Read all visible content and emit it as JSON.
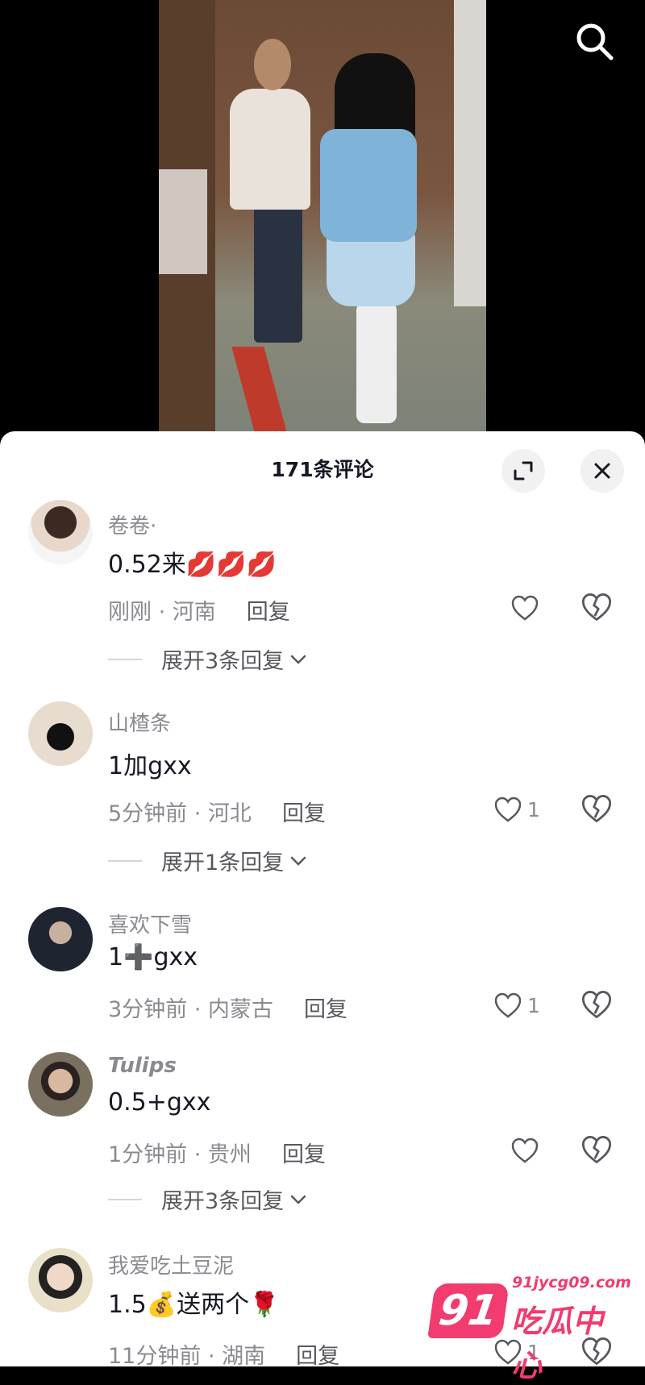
{
  "sheet": {
    "title": "171条评论"
  },
  "comments": [
    {
      "username": "卷卷·",
      "text": "0.52来💋💋💋",
      "time_location": "刚刚 · 河南",
      "reply_label": "回复",
      "likes": "",
      "expand_label": "展开3条回复"
    },
    {
      "username": "山楂条",
      "text": "1加gxx",
      "time_location": "5分钟前 · 河北",
      "reply_label": "回复",
      "likes": "1",
      "expand_label": "展开1条回复"
    },
    {
      "username": "喜欢下雪",
      "text": "1➕gxx",
      "time_location": "3分钟前 · 内蒙古",
      "reply_label": "回复",
      "likes": "1",
      "expand_label": ""
    },
    {
      "username": "Tulips",
      "text": "0.5+gxx",
      "time_location": "1分钟前 · 贵州",
      "reply_label": "回复",
      "likes": "",
      "expand_label": "展开3条回复"
    },
    {
      "username": "我爱吃土豆泥",
      "text": "1.5💰送两个🌹",
      "time_location": "11分钟前 · 湖南",
      "reply_label": "回复",
      "likes": "1",
      "expand_label": ""
    }
  ],
  "watermark": {
    "badge": "91",
    "url": "91jycg09.com",
    "name": "吃瓜中心"
  },
  "icons": {
    "search": "search-icon",
    "expand": "expand-icon",
    "close": "close-icon",
    "like": "heart-icon",
    "dislike": "broken-heart-icon",
    "chevron": "chevron-down-icon"
  },
  "colors": {
    "text_primary": "#161823",
    "text_secondary": "#8a8b91",
    "brand_pink": "#f23b6e"
  }
}
